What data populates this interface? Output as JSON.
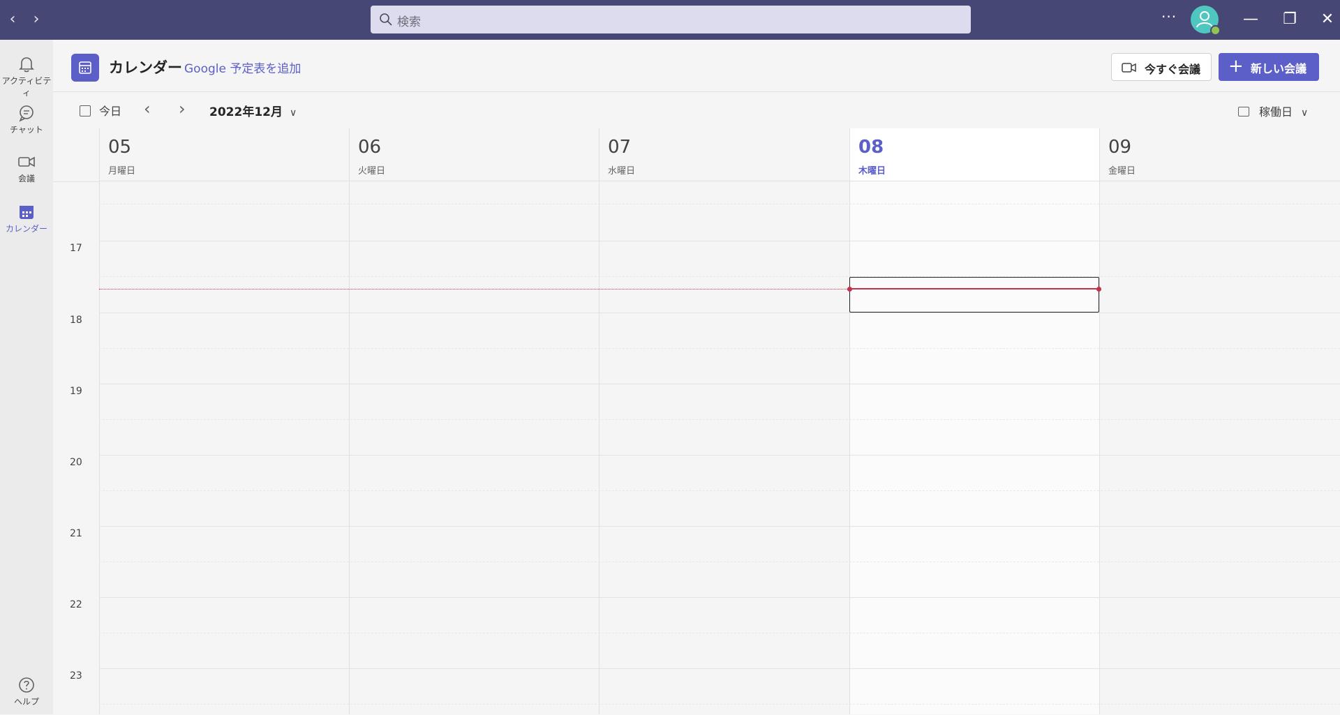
{
  "titlebar": {
    "back_icon": "chevron-left-icon",
    "forward_icon": "chevron-right-icon",
    "search_placeholder": "検索",
    "more_label": "···",
    "minimize_label": "—",
    "restore_label": "❐",
    "close_label": "✕",
    "accent_color": "#464775"
  },
  "rail": {
    "items": [
      {
        "label": "アクティビティ",
        "icon": "bell-icon"
      },
      {
        "label": "チャット",
        "icon": "chat-icon"
      },
      {
        "label": "会議",
        "icon": "video-icon"
      },
      {
        "label": "カレンダー",
        "icon": "calendar-icon",
        "active": true
      },
      {
        "label": "ヘルプ",
        "icon": "help-icon"
      }
    ]
  },
  "header": {
    "title": "カレンダー",
    "google_link": "Google 予定表を追加",
    "meet_now_label": "今すぐ会議",
    "new_meeting_label": "新しい会議",
    "brand_color": "#5b5fc7"
  },
  "toolbar": {
    "today_label": "今日",
    "month_label": "2022年12月",
    "view_label": "稼働日"
  },
  "week": {
    "days": [
      {
        "num": "05",
        "dow": "月曜日"
      },
      {
        "num": "06",
        "dow": "火曜日"
      },
      {
        "num": "07",
        "dow": "水曜日"
      },
      {
        "num": "08",
        "dow": "木曜日",
        "today": true
      },
      {
        "num": "09",
        "dow": "金曜日"
      }
    ],
    "hours": [
      "17",
      "18",
      "19",
      "20",
      "21",
      "22",
      "23"
    ]
  }
}
